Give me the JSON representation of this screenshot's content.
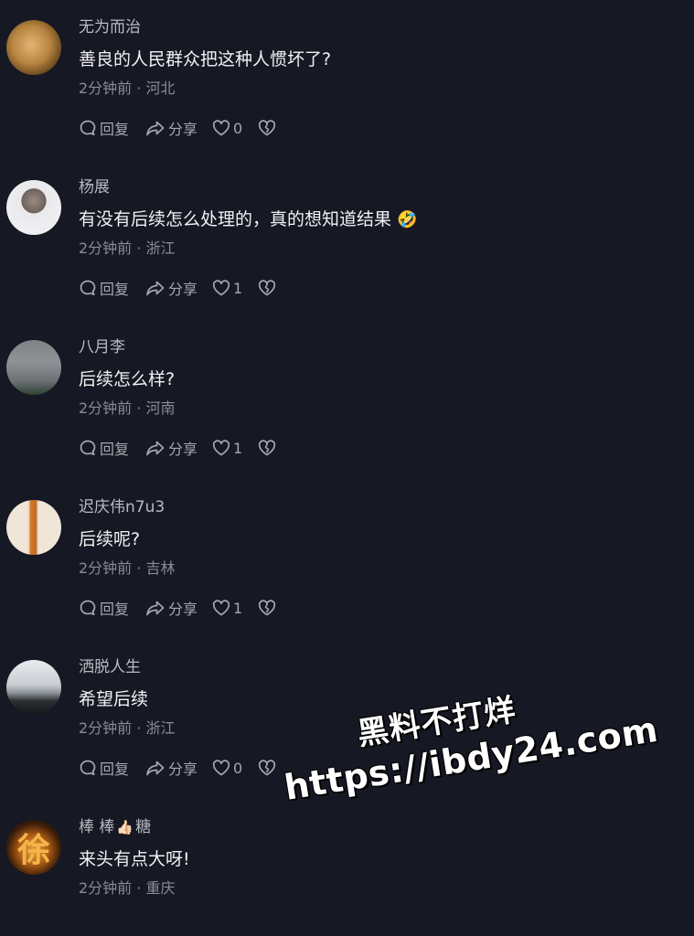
{
  "comments": [
    {
      "username": "无为而治",
      "text": "善良的人民群众把这种人惯坏了?",
      "time": "2分钟前",
      "location": "河北",
      "reply": "回复",
      "share": "分享",
      "likes": "0"
    },
    {
      "username": "杨展",
      "text": "有没有后续怎么处理的，真的想知道结果",
      "emoji": "🤣",
      "time": "2分钟前",
      "location": "浙江",
      "reply": "回复",
      "share": "分享",
      "likes": "1"
    },
    {
      "username": "八月李",
      "text": "后续怎么样?",
      "time": "2分钟前",
      "location": "河南",
      "reply": "回复",
      "share": "分享",
      "likes": "1"
    },
    {
      "username": "迟庆伟n7u3",
      "text": "后续呢?",
      "time": "2分钟前",
      "location": "吉林",
      "reply": "回复",
      "share": "分享",
      "likes": "1"
    },
    {
      "username": "洒脱人生",
      "text": "希望后续",
      "time": "2分钟前",
      "location": "浙江",
      "reply": "回复",
      "share": "分享",
      "likes": "0"
    },
    {
      "username": "棒 棒",
      "username_suffix": "糖",
      "username_emoji": "👍🏻",
      "text": "来头有点大呀!",
      "time": "2分钟前",
      "location": "重庆",
      "avatar_glyph": "徐"
    }
  ],
  "meta_separator": "·",
  "watermark": {
    "line1": "黑料不打烊",
    "line2": "https://ibdy24.com"
  }
}
